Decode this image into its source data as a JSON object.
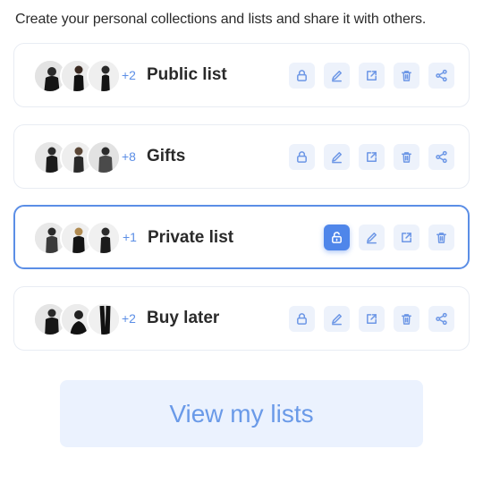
{
  "intro_text": "Create your personal collections and lists and share it with others.",
  "colors": {
    "accent": "#4f86ea",
    "action_bg": "#edf2fb",
    "card_border": "#e8ecf3",
    "active_border": "#5b8ee6",
    "cta_bg": "#ebf2fe",
    "cta_text": "#6a9ae8"
  },
  "lists": [
    {
      "name": "Public list",
      "more_count": "+2",
      "active": false,
      "actions": [
        "lock-icon",
        "edit-icon",
        "open-external-icon",
        "trash-icon",
        "share-icon"
      ]
    },
    {
      "name": "Gifts",
      "more_count": "+8",
      "active": false,
      "actions": [
        "lock-icon",
        "edit-icon",
        "open-external-icon",
        "trash-icon",
        "share-icon"
      ]
    },
    {
      "name": "Private list",
      "more_count": "+1",
      "active": true,
      "actions": [
        "unlock-icon",
        "edit-icon",
        "open-external-icon",
        "trash-icon"
      ]
    },
    {
      "name": "Buy later",
      "more_count": "+2",
      "active": false,
      "actions": [
        "lock-icon",
        "edit-icon",
        "open-external-icon",
        "trash-icon",
        "share-icon"
      ]
    }
  ],
  "cta_label": "View my lists"
}
